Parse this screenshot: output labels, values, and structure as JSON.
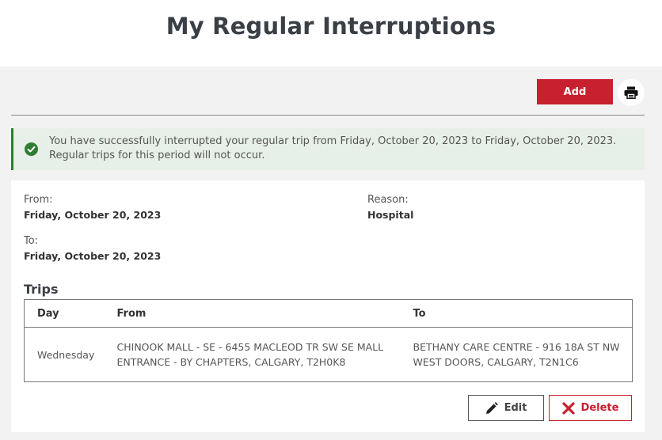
{
  "page": {
    "title": "My Regular Interruptions"
  },
  "toolbar": {
    "add_label": "Add",
    "print_icon": "printer-icon"
  },
  "alert": {
    "icon": "check-circle-icon",
    "message": "You have successfully interrupted your regular trip from Friday, October 20, 2023 to Friday, October 20, 2023. Regular trips for this period will not occur."
  },
  "interruption": {
    "from_label": "From:",
    "from_value": "Friday, October 20, 2023",
    "to_label": "To:",
    "to_value": "Friday, October 20, 2023",
    "reason_label": "Reason:",
    "reason_value": "Hospital"
  },
  "trips": {
    "title": "Trips",
    "columns": [
      "Day",
      "From",
      "To"
    ],
    "rows": [
      {
        "day": "Wednesday",
        "from_line1": "CHINOOK MALL - SE - 6455 MACLEOD TR SW SE MALL",
        "from_line2": "ENTRANCE - BY CHAPTERS, CALGARY, T2H0K8",
        "to_line1": "BETHANY CARE CENTRE - 916 18A ST NW",
        "to_line2": "WEST DOORS, CALGARY, T2N1C6"
      }
    ]
  },
  "actions": {
    "edit_label": "Edit",
    "delete_label": "Delete"
  },
  "colors": {
    "brand_red": "#c8202f",
    "success_green": "#2e7d32",
    "success_bg": "#e7f0e8"
  }
}
